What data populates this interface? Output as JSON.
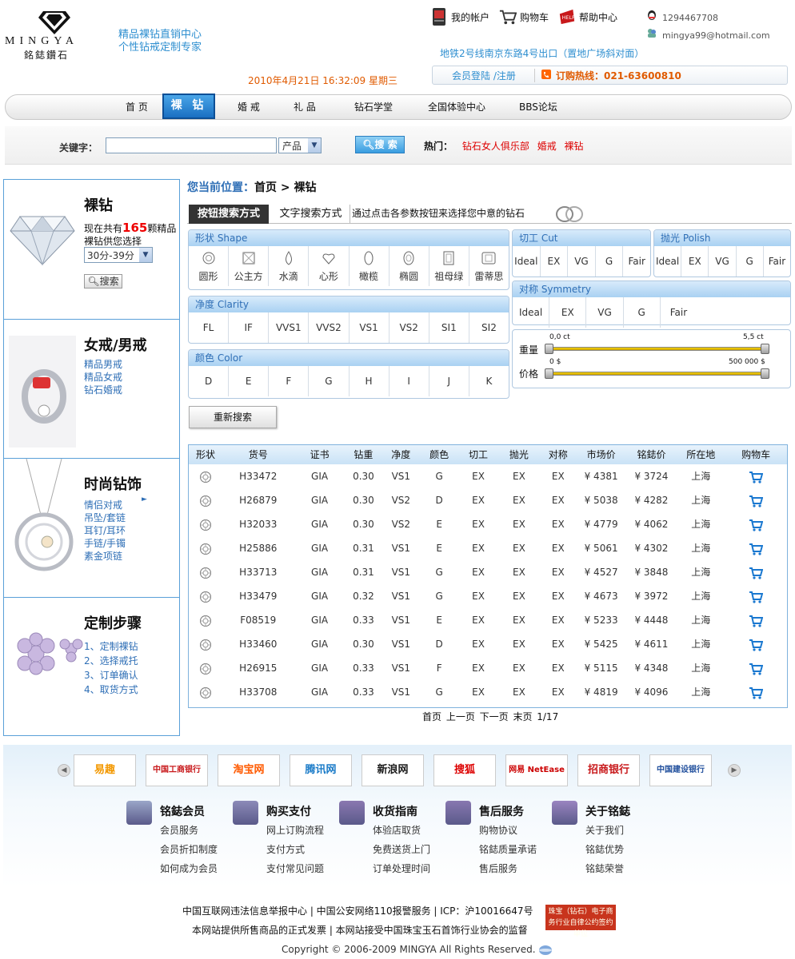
{
  "header": {
    "logo_en": "MINGYA",
    "logo_cn": "銘鋕鑽石",
    "slogan_1": "精品裸钻直销中心",
    "slogan_2": "个性钻戒定制专家",
    "datetime": "2010年4月21日  16:32:09 星期三",
    "top_links": [
      "我的帐户",
      "购物车",
      "帮助中心"
    ],
    "qq": "1294467708",
    "email": "mingya99@hotmail.com",
    "address": "地铁2号线南京东路4号出口（置地广场斜对面）",
    "login": "会员登陆 /注册",
    "hotline": "订购热线：021-63600810"
  },
  "nav": {
    "items": [
      "首 页",
      "裸 钻",
      "婚 戒",
      "礼 品",
      "钻石学堂",
      "全国体验中心",
      "BBS论坛"
    ]
  },
  "search": {
    "label": "关键字：",
    "type": "产品",
    "button": "搜 索",
    "hot_label": "热门：",
    "hot": [
      "钻石女人俱乐部",
      "婚戒",
      "裸钻"
    ]
  },
  "sidebar": {
    "loose": {
      "title": "裸钻",
      "text_1": "现在共有",
      "count": "165",
      "text_2": "颗精品",
      "text_3": "裸钻供您选择",
      "select": "30分-39分",
      "button": "搜索"
    },
    "rings": {
      "title": "女戒/男戒",
      "links": [
        "精品男戒",
        "精品女戒",
        "钻石婚戒"
      ]
    },
    "jewelry": {
      "title": "时尚钻饰",
      "links": [
        "情侣对戒",
        "吊坠/套链",
        "耳钉/耳环",
        "手链/手镯",
        "素金项链"
      ]
    },
    "custom": {
      "title": "定制步骤",
      "links": [
        "1、定制裸钻",
        "2、选择戒托",
        "3、订单确认",
        "4、取货方式"
      ]
    }
  },
  "breadcrumb": {
    "label": "您当前位置：",
    "path": "首页 > 裸钻"
  },
  "tabs": {
    "active": "按钮搜索方式",
    "other": "文字搜索方式",
    "hint": "通过点击各参数按钮来选择您中意的钻石"
  },
  "filters": {
    "shape": {
      "title": "形状  Shape",
      "items": [
        "圆形",
        "公主方",
        "水滴",
        "心形",
        "橄榄",
        "椭圆",
        "祖母绿",
        "雷蒂思"
      ]
    },
    "clarity": {
      "title": "净度  Clarity",
      "items": [
        "FL",
        "IF",
        "VVS1",
        "VVS2",
        "VS1",
        "VS2",
        "SI1",
        "SI2"
      ]
    },
    "color": {
      "title": "颜色  Color",
      "items": [
        "D",
        "E",
        "F",
        "G",
        "H",
        "I",
        "J",
        "K"
      ]
    },
    "cut": {
      "title": "切工  Cut",
      "items": [
        "Ideal",
        "EX",
        "VG",
        "G",
        "Fair"
      ]
    },
    "polish": {
      "title": "抛光  Polish",
      "items": [
        "Ideal",
        "EX",
        "VG",
        "G",
        "Fair"
      ]
    },
    "symmetry": {
      "title": "对称  Symmetry",
      "items": [
        "Ideal",
        "EX",
        "VG",
        "G",
        "Fair"
      ]
    },
    "weight": {
      "label": "重量",
      "min": "0,0 ct",
      "max": "5,5 ct"
    },
    "price": {
      "label": "价格",
      "min": "0 $",
      "max": "500 000 $"
    },
    "reset": "重新搜索"
  },
  "results": {
    "headers": [
      "形状",
      "货号",
      "证书",
      "钻重",
      "净度",
      "颜色",
      "切工",
      "抛光",
      "对称",
      "市场价",
      "铭鋕价",
      "所在地",
      "购物车"
    ],
    "rows": [
      [
        "H33472",
        "GIA",
        "0.30",
        "VS1",
        "G",
        "EX",
        "EX",
        "EX",
        "¥ 4381",
        "¥ 3724",
        "上海"
      ],
      [
        "H26879",
        "GIA",
        "0.30",
        "VS2",
        "D",
        "EX",
        "EX",
        "EX",
        "¥ 5038",
        "¥ 4282",
        "上海"
      ],
      [
        "H32033",
        "GIA",
        "0.30",
        "VS2",
        "E",
        "EX",
        "EX",
        "EX",
        "¥ 4779",
        "¥ 4062",
        "上海"
      ],
      [
        "H25886",
        "GIA",
        "0.31",
        "VS1",
        "E",
        "EX",
        "EX",
        "EX",
        "¥ 5061",
        "¥ 4302",
        "上海"
      ],
      [
        "H33713",
        "GIA",
        "0.31",
        "VS1",
        "G",
        "EX",
        "EX",
        "EX",
        "¥ 4527",
        "¥ 3848",
        "上海"
      ],
      [
        "H33479",
        "GIA",
        "0.32",
        "VS1",
        "G",
        "EX",
        "EX",
        "EX",
        "¥ 4673",
        "¥ 3972",
        "上海"
      ],
      [
        "F08519",
        "GIA",
        "0.33",
        "VS1",
        "E",
        "EX",
        "EX",
        "EX",
        "¥ 5233",
        "¥ 4448",
        "上海"
      ],
      [
        "H33460",
        "GIA",
        "0.30",
        "VS1",
        "D",
        "EX",
        "EX",
        "EX",
        "¥ 5425",
        "¥ 4611",
        "上海"
      ],
      [
        "H26915",
        "GIA",
        "0.33",
        "VS1",
        "F",
        "EX",
        "EX",
        "EX",
        "¥ 5115",
        "¥ 4348",
        "上海"
      ],
      [
        "H33708",
        "GIA",
        "0.33",
        "VS1",
        "G",
        "EX",
        "EX",
        "EX",
        "¥ 4819",
        "¥ 4096",
        "上海"
      ]
    ],
    "pager": "首页  上一页  下一页  末页  1/17"
  },
  "partners": [
    "易趣",
    "中国工商银行",
    "淘宝网",
    "腾讯网",
    "新浪网",
    "搜狐",
    "网易 NetEase",
    "招商银行",
    "中国建设银行"
  ],
  "footer_cols": [
    {
      "title": "铭鋕会员",
      "links": [
        "会员服务",
        "会员折扣制度",
        "如何成为会员"
      ],
      "color": "#9aa6c8"
    },
    {
      "title": "购买支付",
      "links": [
        "网上订购流程",
        "支付方式",
        "支付常见问题"
      ],
      "color": "#8c8ab8"
    },
    {
      "title": "收货指南",
      "links": [
        "体验店取货",
        "免费送货上门",
        "订单处理时间"
      ],
      "color": "#8a78b0"
    },
    {
      "title": "售后服务",
      "links": [
        "购物协议",
        "铭鋕质量承诺",
        "售后服务"
      ],
      "color": "#8878b0"
    },
    {
      "title": "关于铭鋕",
      "links": [
        "关于我们",
        "铭鋕优势",
        "铭鋕荣誉"
      ],
      "color": "#9a84c0"
    }
  ],
  "footer": {
    "line1": "中国互联网违法信息举报中心 | 中国公安网络110报警服务 | ICP：沪10016647号",
    "line2": "本网站提供所售商品的正式发票 | 本网站接受中国珠宝玉石首饰行业协会的监督",
    "line3": "Copyright © 2006-2009 MINGYA All Rights Reserved.",
    "badge": "珠宝（钻石）电子商务行业自律公约签约单位"
  },
  "colors": {
    "accent": "#2f8fd0",
    "hot": "#e05a00",
    "cart": "#1a78d0"
  }
}
